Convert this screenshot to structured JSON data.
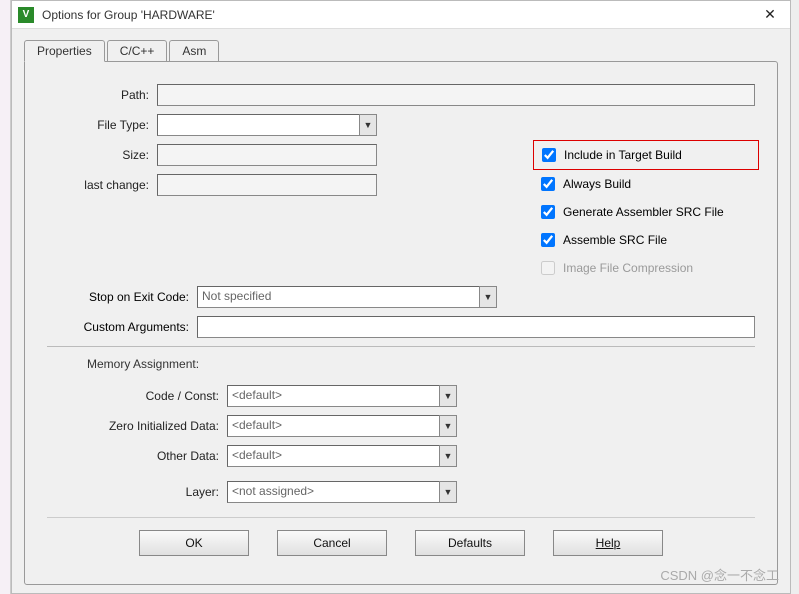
{
  "window": {
    "title": "Options for Group 'HARDWARE'"
  },
  "tabs": {
    "t0": "Properties",
    "t1": "C/C++",
    "t2": "Asm"
  },
  "labels": {
    "path": "Path:",
    "file_type": "File Type:",
    "size": "Size:",
    "last_change": "last change:",
    "stop_on_exit": "Stop on Exit Code:",
    "custom_args": "Custom Arguments:",
    "memory_assignment": "Memory Assignment:",
    "code_const": "Code / Const:",
    "zero_init": "Zero Initialized Data:",
    "other_data": "Other Data:",
    "layer": "Layer:"
  },
  "fields": {
    "path": "",
    "file_type": "",
    "size": "",
    "last_change": "",
    "stop_on_exit": "Not specified",
    "custom_args": "",
    "code_const": "<default>",
    "zero_init": "<default>",
    "other_data": "<default>",
    "layer": "<not assigned>"
  },
  "checks": {
    "include_in_build": "Include in Target Build",
    "always_build": "Always Build",
    "gen_asm_src": "Generate Assembler SRC File",
    "assemble_src": "Assemble SRC File",
    "image_compress": "Image File Compression"
  },
  "buttons": {
    "ok": "OK",
    "cancel": "Cancel",
    "defaults": "Defaults",
    "help": "Help"
  },
  "watermark": "CSDN @念一不念工"
}
